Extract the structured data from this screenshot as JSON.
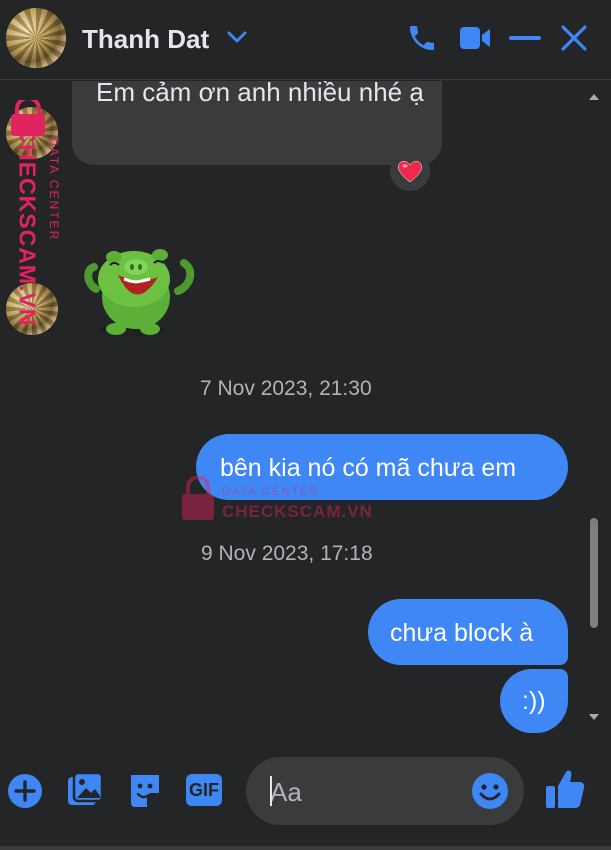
{
  "header": {
    "contact_name": "Thanh Dat",
    "icons": [
      "avatar",
      "chevron-down-icon",
      "phone-icon",
      "video-icon",
      "minimize-icon",
      "close-icon"
    ],
    "accent_color": "#3e87f5"
  },
  "messages": {
    "incoming_text": "Em cảm ơn anh nhiều nhé ạ",
    "reaction": "❤️",
    "sticker": "green-pig-sticker",
    "timestamp_1": "7 Nov 2023, 21:30",
    "outgoing_1": "bên kia nó có mã chưa em",
    "timestamp_2": "9 Nov 2023, 17:18",
    "outgoing_2": "chưa block à",
    "outgoing_3": ":))"
  },
  "watermark": {
    "brand": "CHECKSCAM.VN",
    "subtitle": "DATA CENTER",
    "color": "#e0245e"
  },
  "composer": {
    "placeholder": "Aa",
    "icons": [
      "plus-icon",
      "photo-icon",
      "sticker-icon",
      "gif-icon",
      "emoji-icon",
      "like-icon"
    ],
    "gif_label": "GIF"
  }
}
